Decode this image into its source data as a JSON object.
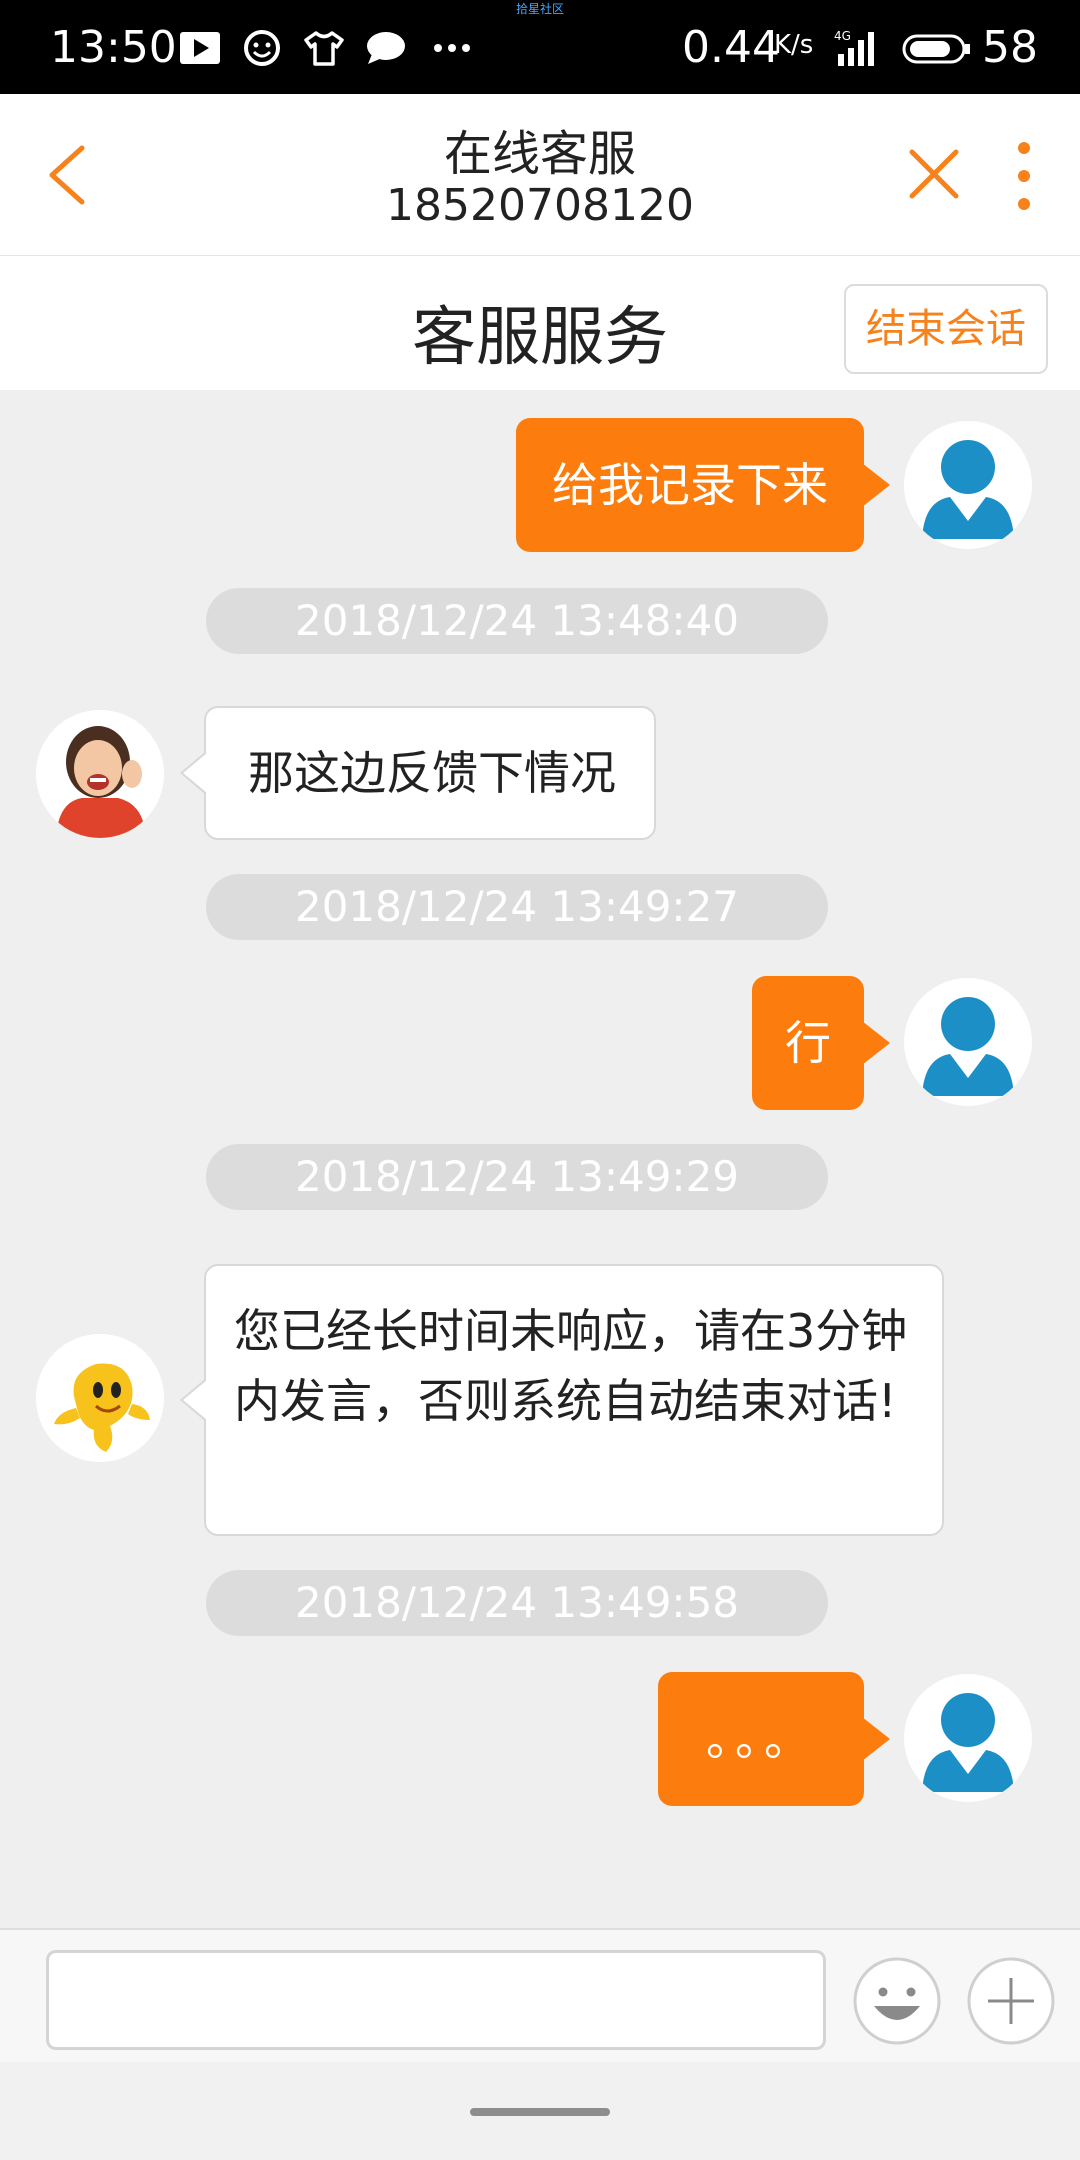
{
  "status_bar": {
    "time": "13:50",
    "carrier_tag": "拾星社区",
    "net_speed": "0.44",
    "net_speed_unit": "K/s",
    "battery": "58"
  },
  "navbar": {
    "title": "在线客服",
    "subtitle": "18520708120"
  },
  "service_header": {
    "title": "客服服务",
    "end_button": "结束会话"
  },
  "messages": [
    {
      "direction": "out",
      "text": "给我记录下来"
    },
    {
      "timestamp": "2018/12/24 13:48:40"
    },
    {
      "direction": "in",
      "text": "那这边反馈下情况"
    },
    {
      "timestamp": "2018/12/24 13:49:27"
    },
    {
      "direction": "out",
      "text": "行"
    },
    {
      "timestamp": "2018/12/24 13:49:29"
    },
    {
      "direction": "in",
      "text": "您已经长时间未响应，请在3分钟内发言，否则系统自动结束对话!"
    },
    {
      "timestamp": "2018/12/24 13:49:58"
    },
    {
      "direction": "out",
      "text": "。。。"
    }
  ],
  "input": {
    "value": "",
    "placeholder": ""
  },
  "colors": {
    "accent": "#fc7d0d",
    "avatar_blue": "#1b8fc6"
  }
}
